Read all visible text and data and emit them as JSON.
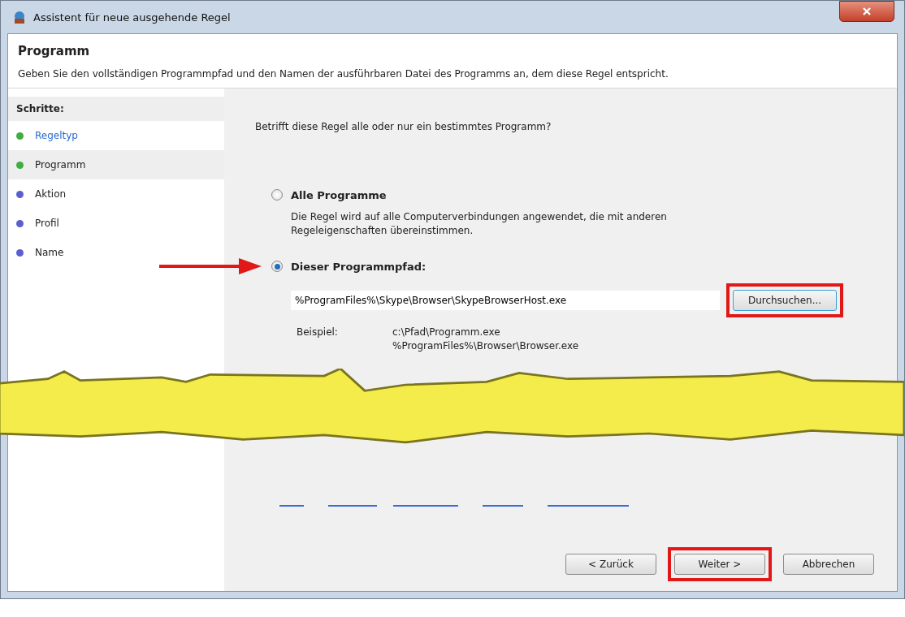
{
  "window": {
    "title": "Assistent für neue ausgehende Regel"
  },
  "header": {
    "title": "Programm",
    "description": "Geben Sie den vollständigen Programmpfad und den Namen der ausführbaren Datei des Programms an, dem diese Regel entspricht."
  },
  "sidebar": {
    "title": "Schritte:",
    "items": [
      {
        "label": "Regeltyp",
        "color": "#3fae3f",
        "link": true,
        "selected": false
      },
      {
        "label": "Programm",
        "color": "#3fae3f",
        "link": false,
        "selected": true
      },
      {
        "label": "Aktion",
        "color": "#5a5fd0",
        "link": false,
        "selected": false
      },
      {
        "label": "Profil",
        "color": "#5a5fd0",
        "link": false,
        "selected": false
      },
      {
        "label": "Name",
        "color": "#5a5fd0",
        "link": false,
        "selected": false
      }
    ]
  },
  "question": "Betrifft diese Regel alle oder nur ein bestimmtes Programm?",
  "options": [
    {
      "label": "Alle Programme",
      "description": "Die Regel wird auf alle Computerverbindungen angewendet, die mit anderen Regeleigenschaften übereinstimmen.",
      "selected": false,
      "arrow": false
    },
    {
      "label": "Dieser Programmpfad:",
      "selected": true,
      "arrow": true
    }
  ],
  "path_field": {
    "value": "%ProgramFiles%\\Skype\\Browser\\SkypeBrowserHost.exe"
  },
  "browse_button": {
    "label": "Durchsuchen...",
    "highlighted": true
  },
  "example": {
    "label": "Beispiel:",
    "lines": [
      "c:\\Pfad\\Programm.exe",
      "%ProgramFiles%\\Browser\\Browser.exe"
    ]
  },
  "buttons": [
    {
      "label": "< Zurück",
      "highlighted": false
    },
    {
      "label": "Weiter >",
      "highlighted": true
    },
    {
      "label": "Abbrechen",
      "highlighted": false
    }
  ]
}
